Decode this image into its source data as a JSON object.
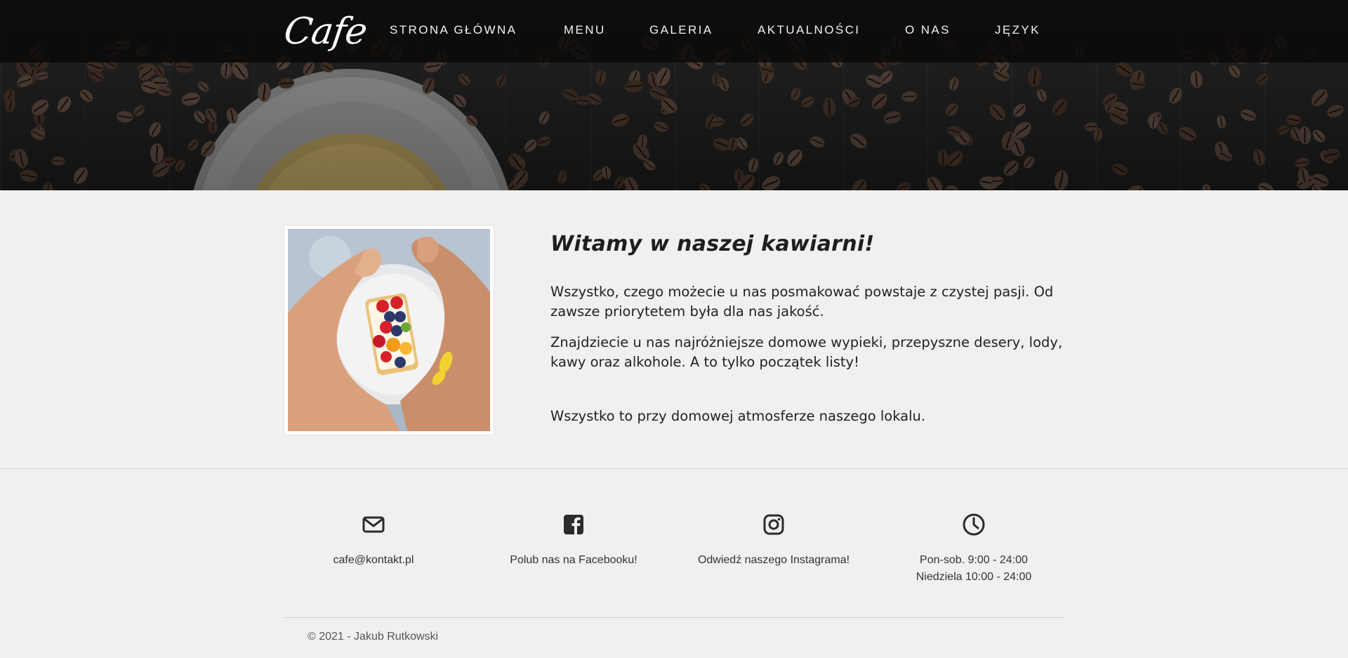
{
  "header": {
    "logo": "Cafe",
    "nav": [
      {
        "label": "STRONA GŁÓWNA"
      },
      {
        "label": "MENU"
      },
      {
        "label": "GALERIA"
      },
      {
        "label": "AKTUALNOŚCI"
      },
      {
        "label": "O NAS"
      },
      {
        "label": "JĘZYK"
      }
    ]
  },
  "main": {
    "title": "Witamy w naszej kawiarni!",
    "paragraphs": [
      "Wszystko, czego możecie u nas posmakować powstaje z czystej pasji. Od zawsze priorytetem była dla nas jakość.",
      "Znajdziecie u nas najróżniejsze domowe wypieki, przepyszne desery, lody, kawy oraz alkohole. A to tylko początek listy!",
      "Wszystko to przy domowej atmosferze naszego lokalu."
    ]
  },
  "footer": {
    "contacts": [
      {
        "icon": "envelope-icon",
        "text": "cafe@kontakt.pl"
      },
      {
        "icon": "facebook-icon",
        "text": "Polub nas na Facebooku!"
      },
      {
        "icon": "instagram-icon",
        "text": "Odwiedź naszego Instagrama!"
      },
      {
        "icon": "clock-icon",
        "text_line1": "Pon-sob. 9:00 - 24:00",
        "text_line2": "Niedziela 10:00 - 24:00"
      }
    ],
    "copyright": "© 2021 - Jakub Rutkowski"
  },
  "colors": {
    "navbar": "#080808",
    "background": "#f0f0f0",
    "text": "#222222",
    "icon": "#2b2b2b"
  }
}
